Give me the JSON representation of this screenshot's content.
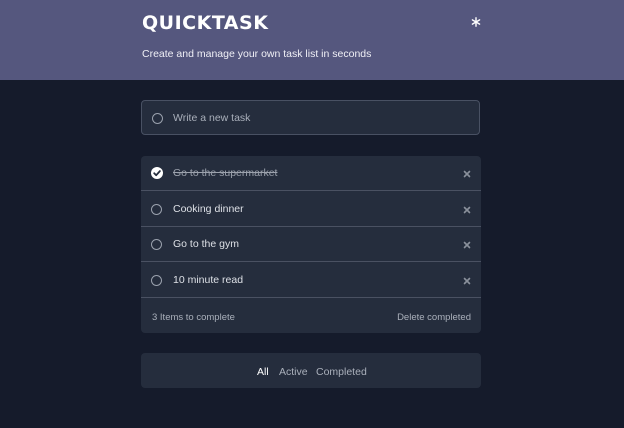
{
  "header": {
    "title": "QUICKTASK",
    "subtitle": "Create and manage your own task list in seconds",
    "theme_icon": "snowflake-icon"
  },
  "new_task": {
    "placeholder": "Write a new task"
  },
  "tasks": [
    {
      "label": "Go to the supermarket",
      "completed": true
    },
    {
      "label": "Cooking dinner",
      "completed": false
    },
    {
      "label": "Go to the gym",
      "completed": false
    },
    {
      "label": "10 minute read",
      "completed": false
    }
  ],
  "footer": {
    "count_label": "3 Items to complete",
    "clear_label": "Delete completed"
  },
  "filters": {
    "all": "All",
    "active": "Active",
    "completed": "Completed",
    "selected": "All"
  },
  "colors": {
    "header_bg": "#55577e",
    "page_bg": "#151b2b",
    "card_bg": "#252d3d",
    "divider": "#4a5162"
  }
}
